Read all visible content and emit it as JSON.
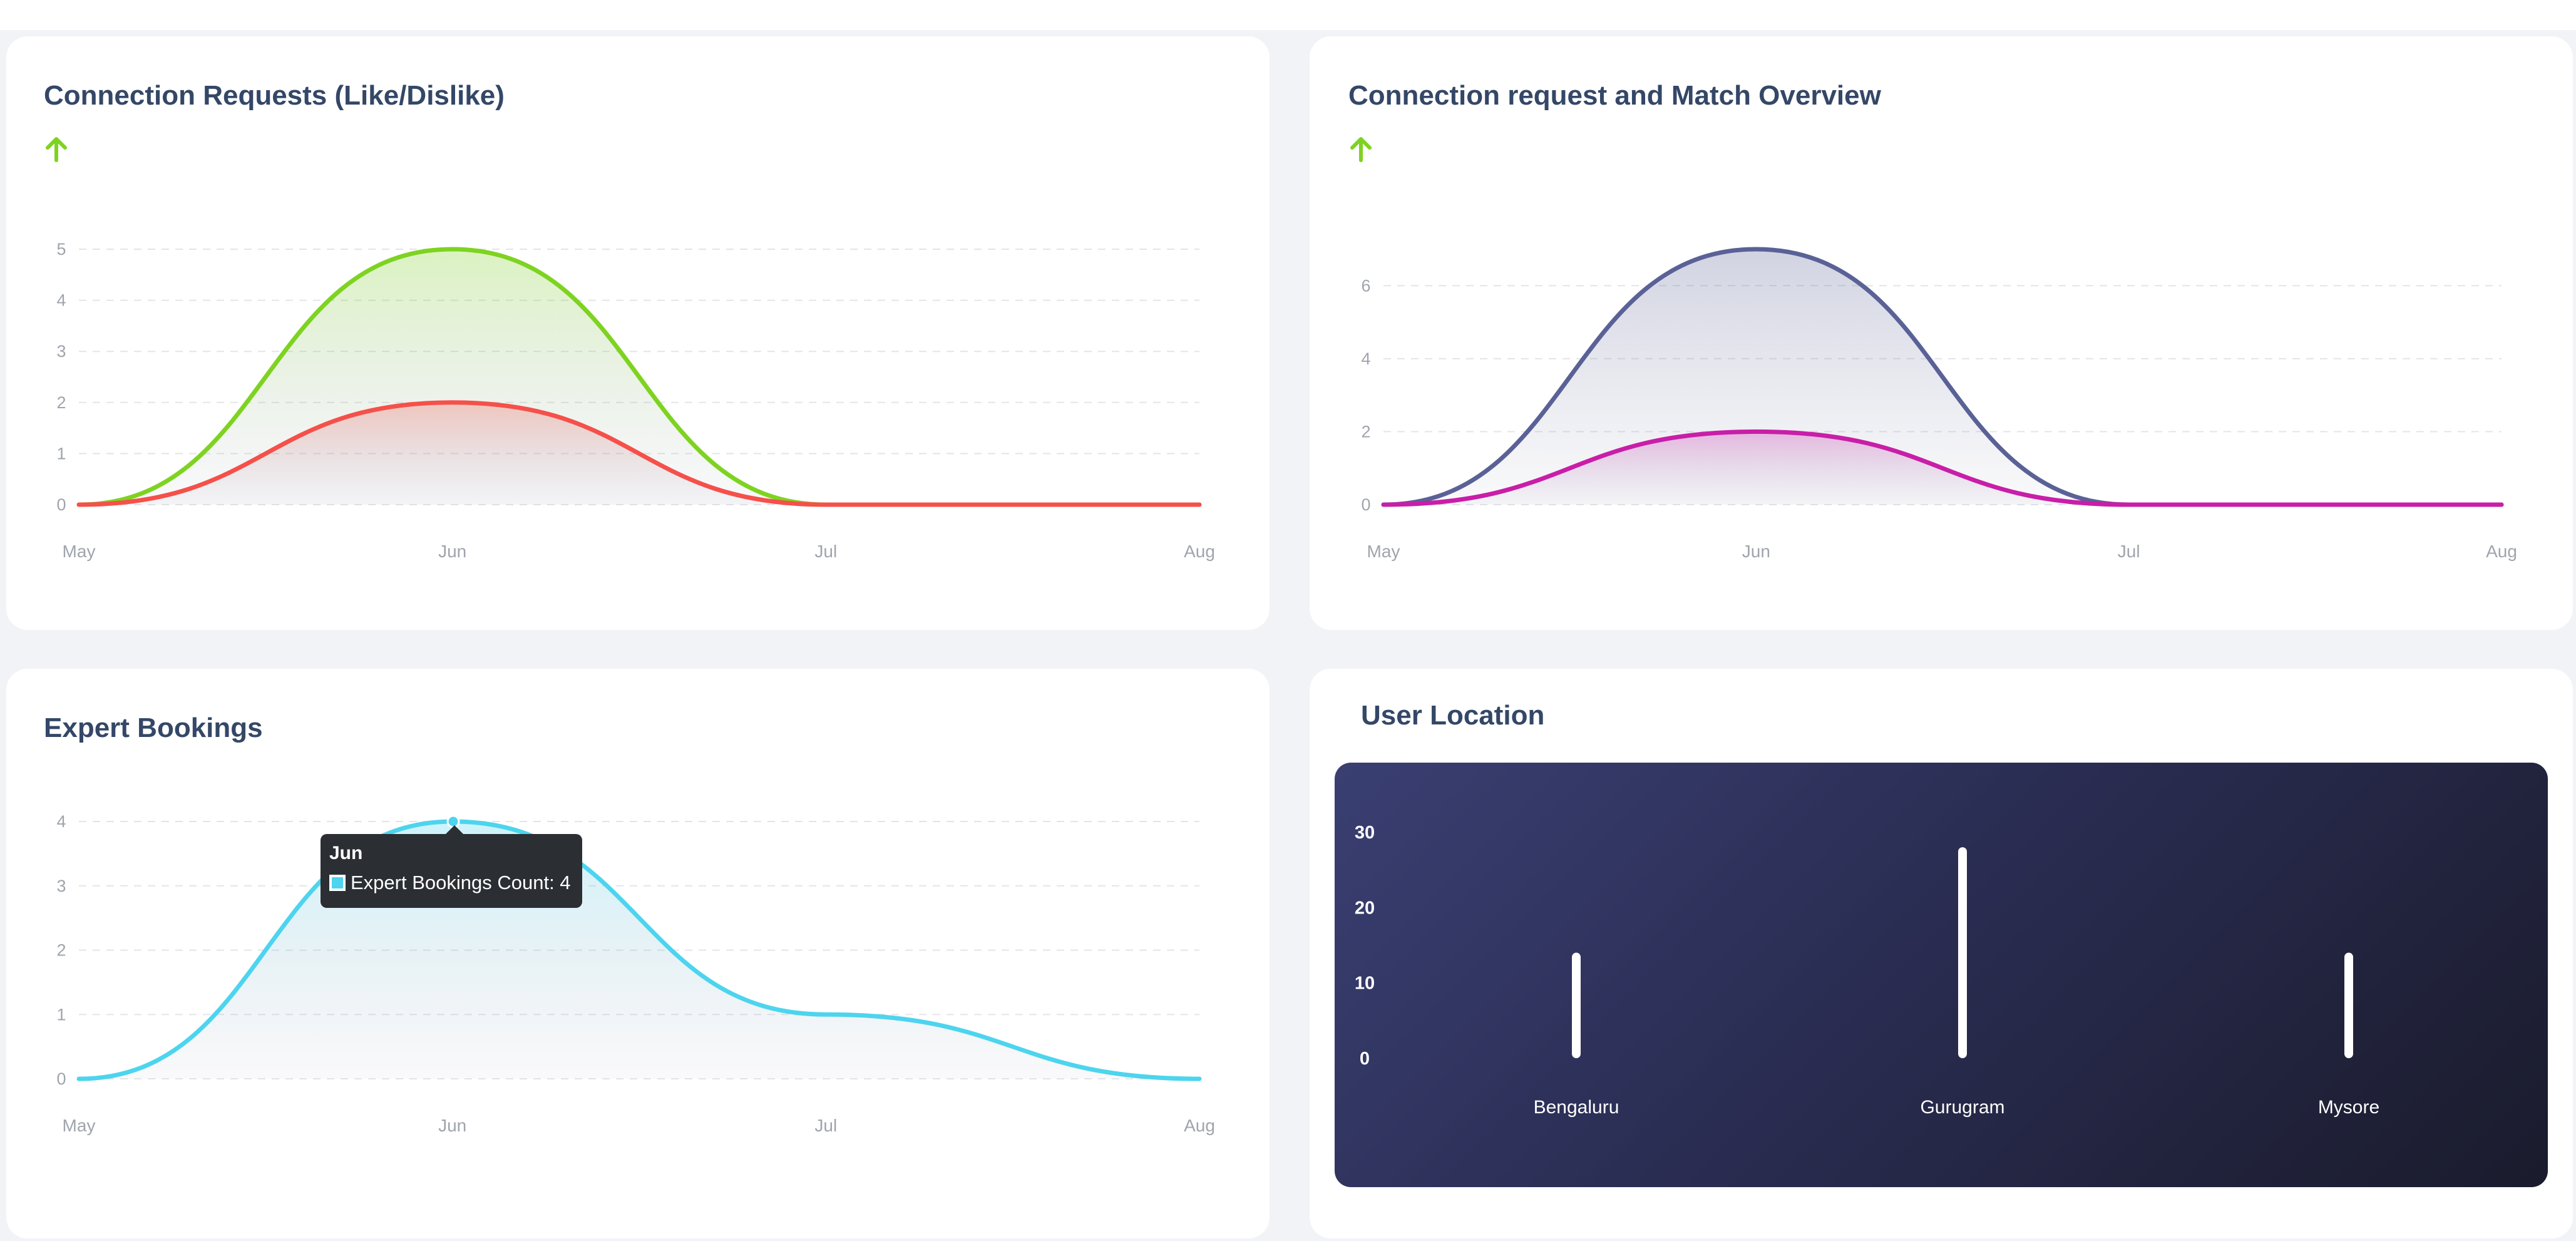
{
  "colors": {
    "green": "#7ed321",
    "red": "#f5504a",
    "navy": "#5a6196",
    "magenta": "#c81ea8",
    "cyan": "#4dd4ee",
    "title": "#344767",
    "tick": "#a0a4ad"
  },
  "charts": {
    "c1": {
      "title": "Connection Requests (Like/Dislike)",
      "icon": "arrow-up-icon"
    },
    "c2": {
      "title": "Connection request and Match Overview",
      "icon": "arrow-up-icon"
    },
    "c3": {
      "title": "Expert Bookings"
    },
    "c4": {
      "title": "User Location"
    }
  },
  "tooltip": {
    "title": "Jun",
    "label": "Expert Bookings Count: 4"
  },
  "chart_data": [
    {
      "type": "area",
      "categories": [
        "May",
        "Jun",
        "Jul",
        "Aug"
      ],
      "ylim": [
        0,
        5
      ],
      "yticks": [
        0,
        1,
        2,
        3,
        4,
        5
      ],
      "grid": true,
      "series": [
        {
          "values": [
            0,
            5,
            0,
            0
          ],
          "color": "#7ed321"
        },
        {
          "values": [
            0,
            2,
            0,
            0
          ],
          "color": "#f5504a"
        }
      ]
    },
    {
      "type": "area",
      "categories": [
        "May",
        "Jun",
        "Jul",
        "Aug"
      ],
      "ylim": [
        0,
        7
      ],
      "yticks": [
        0,
        2,
        4,
        6
      ],
      "grid": true,
      "series": [
        {
          "values": [
            0,
            7,
            0,
            0
          ],
          "color": "#5a6196"
        },
        {
          "values": [
            0,
            2,
            0,
            0
          ],
          "color": "#c81ea8"
        }
      ]
    },
    {
      "type": "area",
      "categories": [
        "May",
        "Jun",
        "Jul",
        "Aug"
      ],
      "ylim": [
        0,
        4
      ],
      "yticks": [
        0,
        1,
        2,
        3,
        4
      ],
      "grid": true,
      "series": [
        {
          "name": "Expert Bookings Count",
          "values": [
            0,
            4,
            1,
            0
          ],
          "color": "#4dd4ee"
        }
      ]
    },
    {
      "type": "bar",
      "categories": [
        "Bengaluru",
        "Gurugram",
        "Mysore"
      ],
      "values": [
        14,
        28,
        14
      ],
      "ylim": [
        0,
        30
      ],
      "yticks": [
        0,
        10,
        20,
        30
      ],
      "grid": false
    }
  ]
}
